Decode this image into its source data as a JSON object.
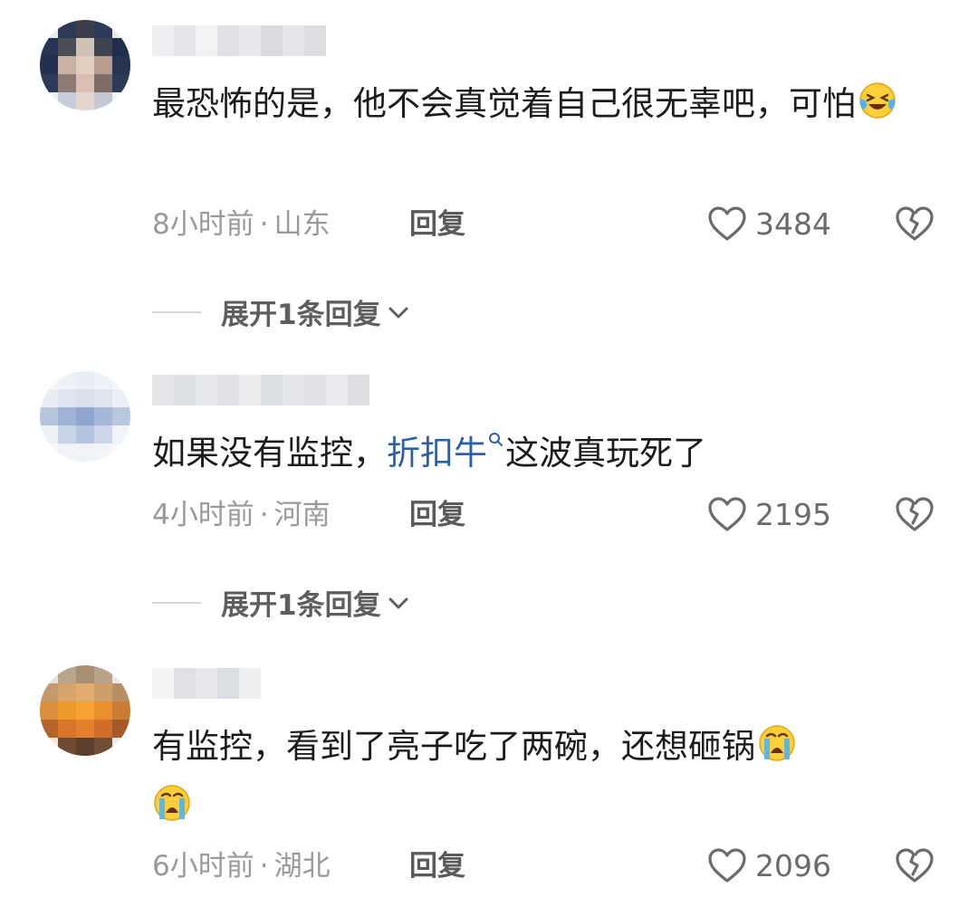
{
  "comments": [
    {
      "content": "最恐怖的是，他不会真觉着自己很无辜吧，可怕",
      "emoji": "grin-squint-tears-emoji",
      "time": "8小时前",
      "location": "山东",
      "reply_label": "回复",
      "likes": "3484",
      "expand_label": "展开1条回复"
    },
    {
      "content_before": "如果没有监控，",
      "link": "折扣牛",
      "content_after": "这波真玩死了",
      "time": "4小时前",
      "location": "河南",
      "reply_label": "回复",
      "likes": "2195",
      "expand_label": "展开1条回复"
    },
    {
      "content": "有监控，看到了亮子吃了两碗，还想砸锅",
      "emoji": "loudly-crying-emoji",
      "time": "6小时前",
      "location": "湖北",
      "reply_label": "回复",
      "likes": "2096"
    }
  ],
  "meta_separator": "·"
}
